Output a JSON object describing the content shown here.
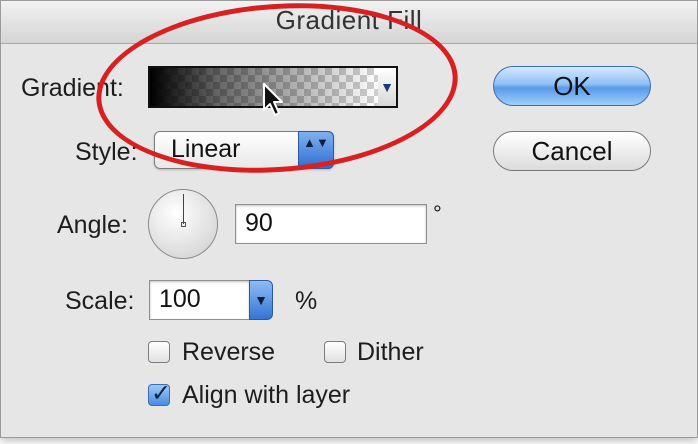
{
  "dialog": {
    "title": "Gradient Fill"
  },
  "gradient": {
    "label": "Gradient:",
    "dropdown_glyph": "▼"
  },
  "style": {
    "label": "Style:",
    "value": "Linear",
    "stepper_glyph": "▲▼"
  },
  "angle": {
    "label": "Angle:",
    "value": "90",
    "unit": "°"
  },
  "scale": {
    "label": "Scale:",
    "value": "100",
    "unit": "%",
    "dropdown_glyph": "▼"
  },
  "options": {
    "reverse": {
      "label": "Reverse",
      "checked": false
    },
    "dither": {
      "label": "Dither",
      "checked": false
    },
    "align": {
      "label": "Align with layer",
      "checked": true,
      "check_glyph": "✓"
    }
  },
  "buttons": {
    "ok": "OK",
    "cancel": "Cancel"
  },
  "colors": {
    "highlight": "#d82020",
    "accent": "#4a8be0"
  },
  "icons": {
    "cursor": "arrow-cursor-icon",
    "dial": "angle-dial-icon"
  }
}
